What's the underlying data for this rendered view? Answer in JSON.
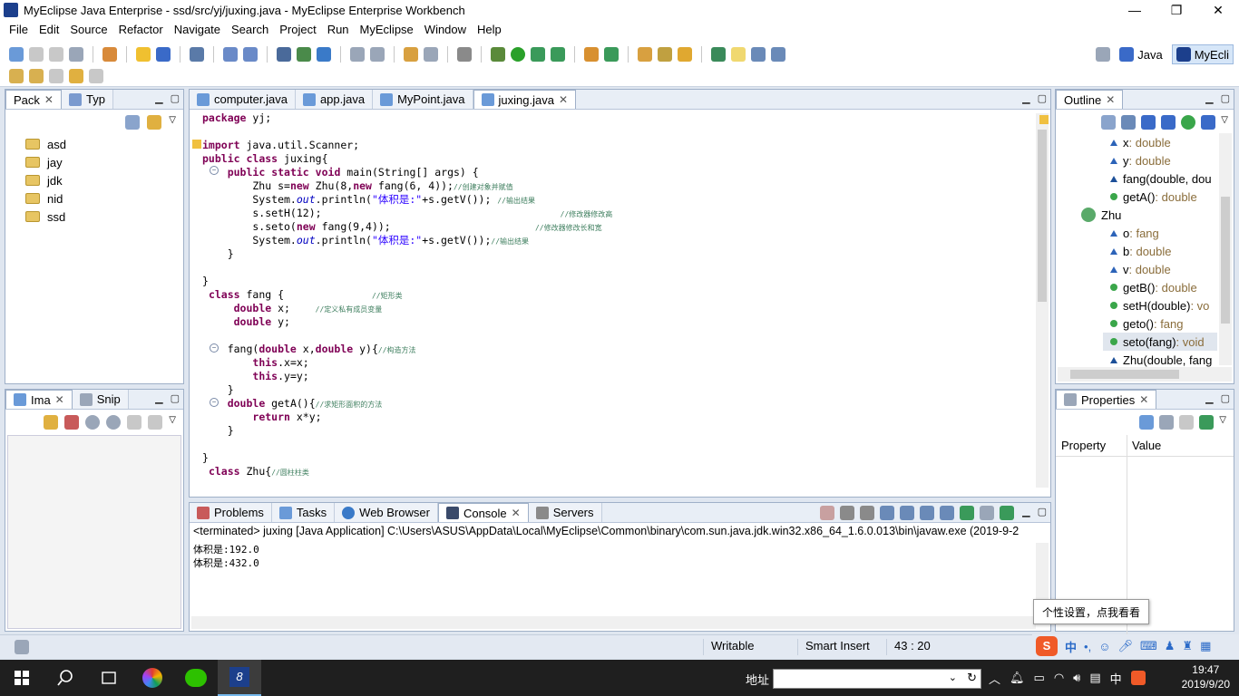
{
  "window": {
    "title": "MyEclipse Java Enterprise - ssd/src/yj/juxing.java - MyEclipse Enterprise Workbench",
    "minimize": "—",
    "restore": "❐",
    "close": "✕"
  },
  "menu": [
    "File",
    "Edit",
    "Source",
    "Refactor",
    "Navigate",
    "Search",
    "Project",
    "Run",
    "MyEclipse",
    "Window",
    "Help"
  ],
  "perspectives": [
    {
      "label": "Java",
      "active": false
    },
    {
      "label": "MyEcli",
      "active": true
    }
  ],
  "package_explorer": {
    "tabs": [
      "Pack",
      "Typ"
    ],
    "items": [
      "asd",
      "jay",
      "jdk",
      "nid",
      "ssd"
    ]
  },
  "image_view": {
    "tabs": [
      "Ima",
      "Snip"
    ]
  },
  "editor": {
    "tabs": [
      "computer.java",
      "app.java",
      "MyPoint.java",
      "juxing.java"
    ],
    "active_tab": "juxing.java"
  },
  "code": [
    "package yj;",
    "",
    "import java.util.Scanner;",
    "public class juxing{",
    "    public static void main(String[] args) {",
    "        Zhu s=new Zhu(8,new fang(6, 4));//创建对象并赋值",
    "        System.out.println(\"体积是:\"+s.getV()); //输出结果",
    "        s.setH(12);                                      //修改器修改高",
    "        s.seto(new fang(9,4));                       //修改器修改长和宽",
    "        System.out.println(\"体积是:\"+s.getV());//输出结果",
    "    }",
    "",
    "}",
    " class fang {              //矩形类",
    "     double x;    //定义私有成员变量",
    "     double y;",
    "",
    "    fang(double x,double y){//构造方法",
    "        this.x=x;",
    "        this.y=y;",
    "    }",
    "    double getA(){//求矩形面积的方法",
    "        return x*y;",
    "    }",
    "",
    "}",
    " class Zhu{//圆柱柱类"
  ],
  "outline": {
    "title": "Outline",
    "items": [
      {
        "name": "x",
        "type": " : double",
        "kind": "field",
        "indent": 1
      },
      {
        "name": "y",
        "type": " : double",
        "kind": "field",
        "indent": 1
      },
      {
        "name": "fang(double, dou",
        "type": "",
        "kind": "ctor",
        "indent": 1
      },
      {
        "name": "getA()",
        "type": " : double",
        "kind": "method",
        "indent": 1
      },
      {
        "name": "Zhu",
        "type": "",
        "kind": "class",
        "indent": 0
      },
      {
        "name": "o",
        "type": " : fang",
        "kind": "field",
        "indent": 1
      },
      {
        "name": "b",
        "type": " : double",
        "kind": "field",
        "indent": 1
      },
      {
        "name": "v",
        "type": " : double",
        "kind": "field",
        "indent": 1
      },
      {
        "name": "getB()",
        "type": " : double",
        "kind": "method",
        "indent": 1
      },
      {
        "name": "setH(double)",
        "type": " : vo",
        "kind": "method",
        "indent": 1
      },
      {
        "name": "geto()",
        "type": " : fang",
        "kind": "method",
        "indent": 1
      },
      {
        "name": "seto(fang)",
        "type": " : void",
        "kind": "method",
        "indent": 1,
        "selected": true
      },
      {
        "name": "Zhu(double, fang",
        "type": "",
        "kind": "ctor",
        "indent": 1
      }
    ]
  },
  "properties": {
    "title": "Properties",
    "col_property": "Property",
    "col_value": "Value"
  },
  "bottom_tabs": [
    "Problems",
    "Tasks",
    "Web Browser",
    "Console",
    "Servers"
  ],
  "console": {
    "header": "<terminated> juxing [Java Application] C:\\Users\\ASUS\\AppData\\Local\\MyEclipse\\Common\\binary\\com.sun.java.jdk.win32.x86_64_1.6.0.013\\bin\\javaw.exe (2019-9-2",
    "lines": [
      "体积是:192.0",
      "体积是:432.0"
    ]
  },
  "status": {
    "writable": "Writable",
    "insert_mode": "Smart Insert",
    "position": "43 : 20"
  },
  "tooltip": "个性设置，点我看看",
  "ime": {
    "logo": "S",
    "lang": "中"
  },
  "taskbar": {
    "address_label": "地址",
    "tray_lang": "中",
    "time": "19:47",
    "date": "2019/9/20"
  }
}
